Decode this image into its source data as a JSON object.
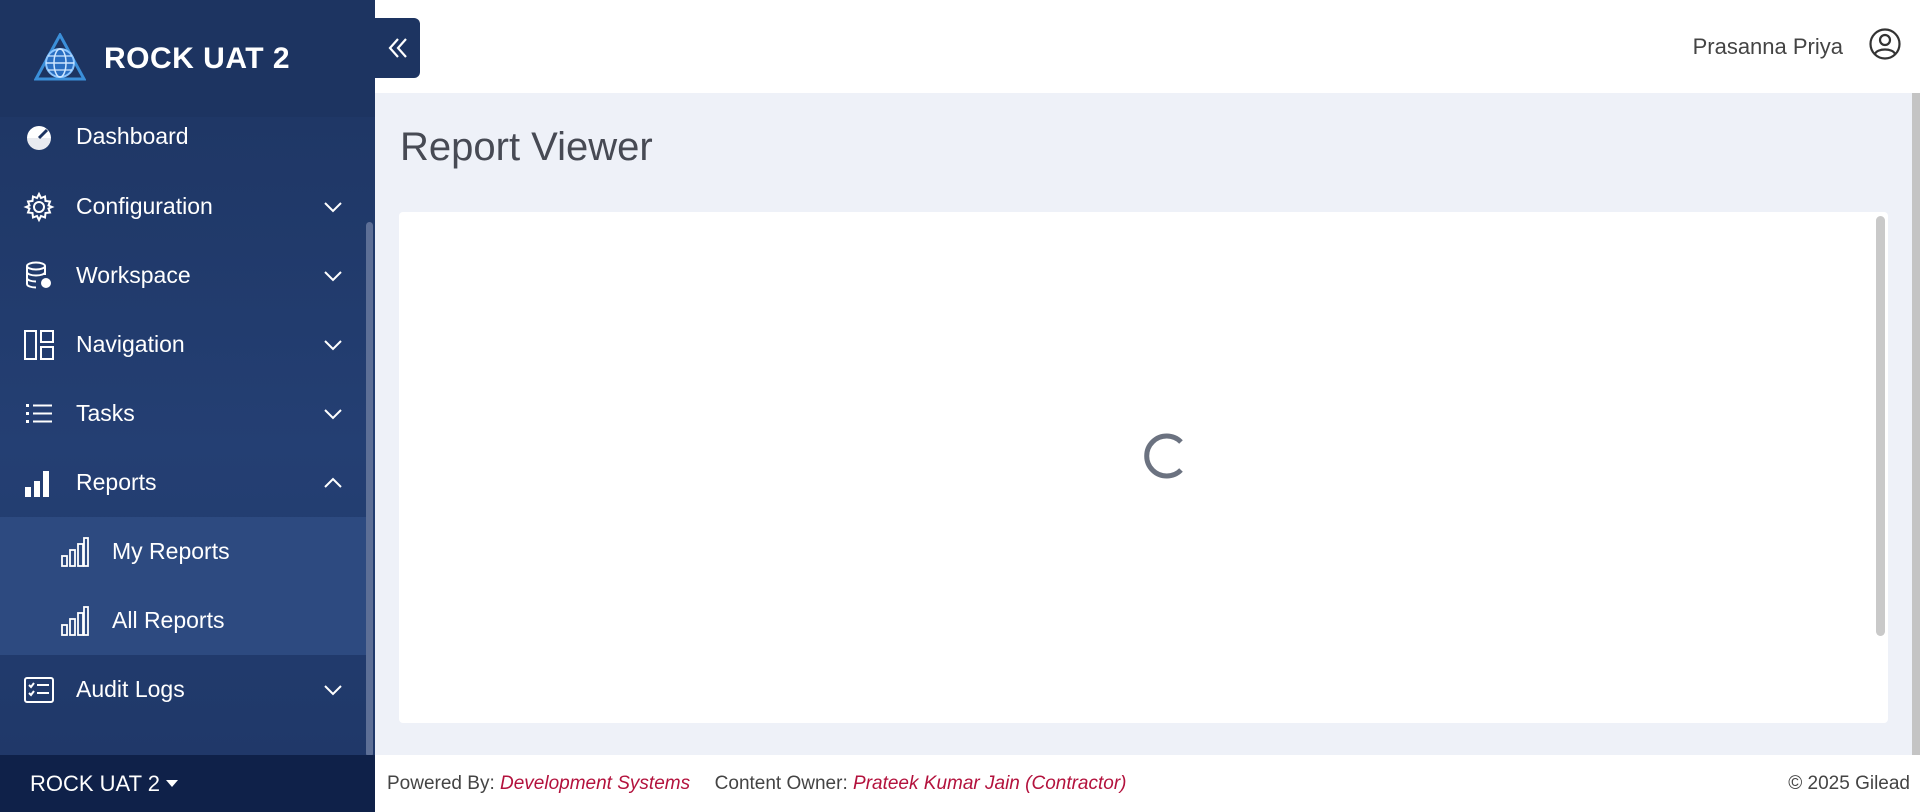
{
  "app": {
    "title": "ROCK UAT 2"
  },
  "sidebar": {
    "items": [
      {
        "label": "Dashboard",
        "icon": "dashboard-icon"
      },
      {
        "label": "Configuration",
        "icon": "gear-icon",
        "expanded": false
      },
      {
        "label": "Workspace",
        "icon": "database-gear-icon",
        "expanded": false
      },
      {
        "label": "Navigation",
        "icon": "layout-icon",
        "expanded": false
      },
      {
        "label": "Tasks",
        "icon": "list-icon",
        "expanded": false
      },
      {
        "label": "Reports",
        "icon": "bar-chart-icon",
        "expanded": true
      },
      {
        "label": "Audit Logs",
        "icon": "checklist-icon",
        "expanded": false
      }
    ],
    "report_subitems": [
      {
        "label": "My Reports",
        "icon": "bar-chart-outline-icon"
      },
      {
        "label": "All Reports",
        "icon": "bar-chart-outline-icon"
      }
    ],
    "footer": {
      "environment": "ROCK UAT 2"
    }
  },
  "header": {
    "user_name": "Prasanna Priya",
    "user_icon": "user-circle-icon"
  },
  "main": {
    "title": "Report Viewer",
    "loading": true
  },
  "footer": {
    "powered_label": "Powered By:",
    "powered_value": "Development Systems",
    "owner_label": "Content Owner:",
    "owner_value": "Prateek Kumar Jain (Contractor)",
    "copyright": "© 2025 Gilead"
  },
  "colors": {
    "sidebar_bg": "#1d3461",
    "submenu_bg": "#2d4a80",
    "sidebar_footer_bg": "#0f2149",
    "link_red": "#b3123d",
    "page_bg": "#eef1f8"
  }
}
